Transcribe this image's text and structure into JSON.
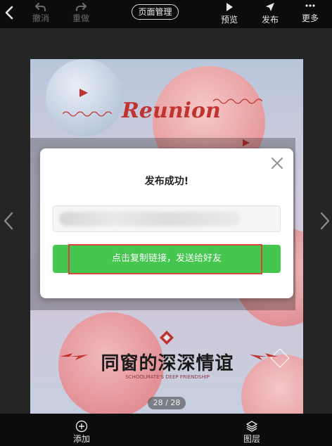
{
  "toolbar": {
    "undo_label": "撤消",
    "redo_label": "重做",
    "pages_label": "页面管理",
    "preview_label": "预览",
    "publish_label": "发布",
    "more_label": "更多",
    "back_icon": "chevron-left-icon"
  },
  "poster": {
    "headline": "Reunion",
    "title": "同窗的深深情谊",
    "subtitle": "SCHOOLMATE'S DEEP FRIENDSHIP",
    "page_indicator": "28 / 28"
  },
  "modal": {
    "title": "发布成功!",
    "link_value": "",
    "copy_button_label": "点击复制链接，发送给好友",
    "highlight_color": "#d8453a",
    "button_color": "#45c74f"
  },
  "bottom_bar": {
    "add_label": "添加",
    "layers_label": "图层"
  }
}
